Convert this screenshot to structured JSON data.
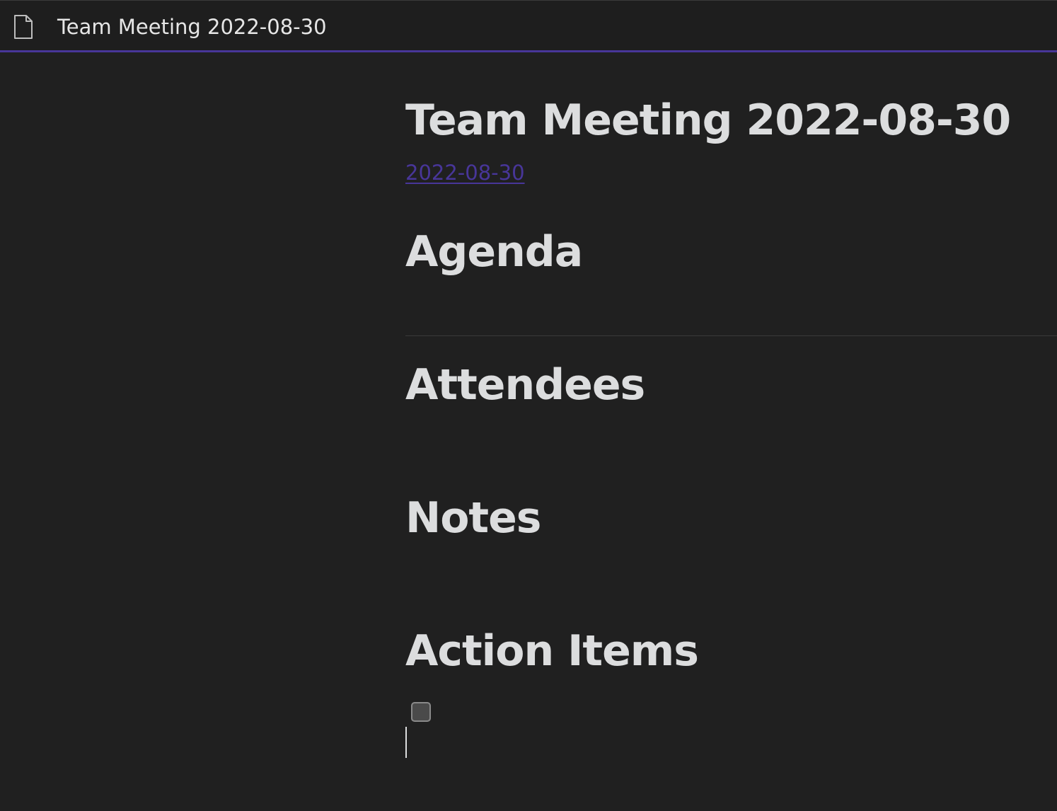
{
  "tab": {
    "title": "Team Meeting 2022-08-30",
    "icon": "file-icon",
    "accent_color": "#483699"
  },
  "note": {
    "title": "Team Meeting 2022-08-30",
    "date_link": "2022-08-30",
    "sections": {
      "agenda": "Agenda",
      "attendees": "Attendees",
      "notes": "Notes",
      "action_items": "Action Items"
    },
    "task_checked": false
  },
  "colors": {
    "background": "#202020",
    "text": "#dcddde",
    "link": "#483699"
  }
}
